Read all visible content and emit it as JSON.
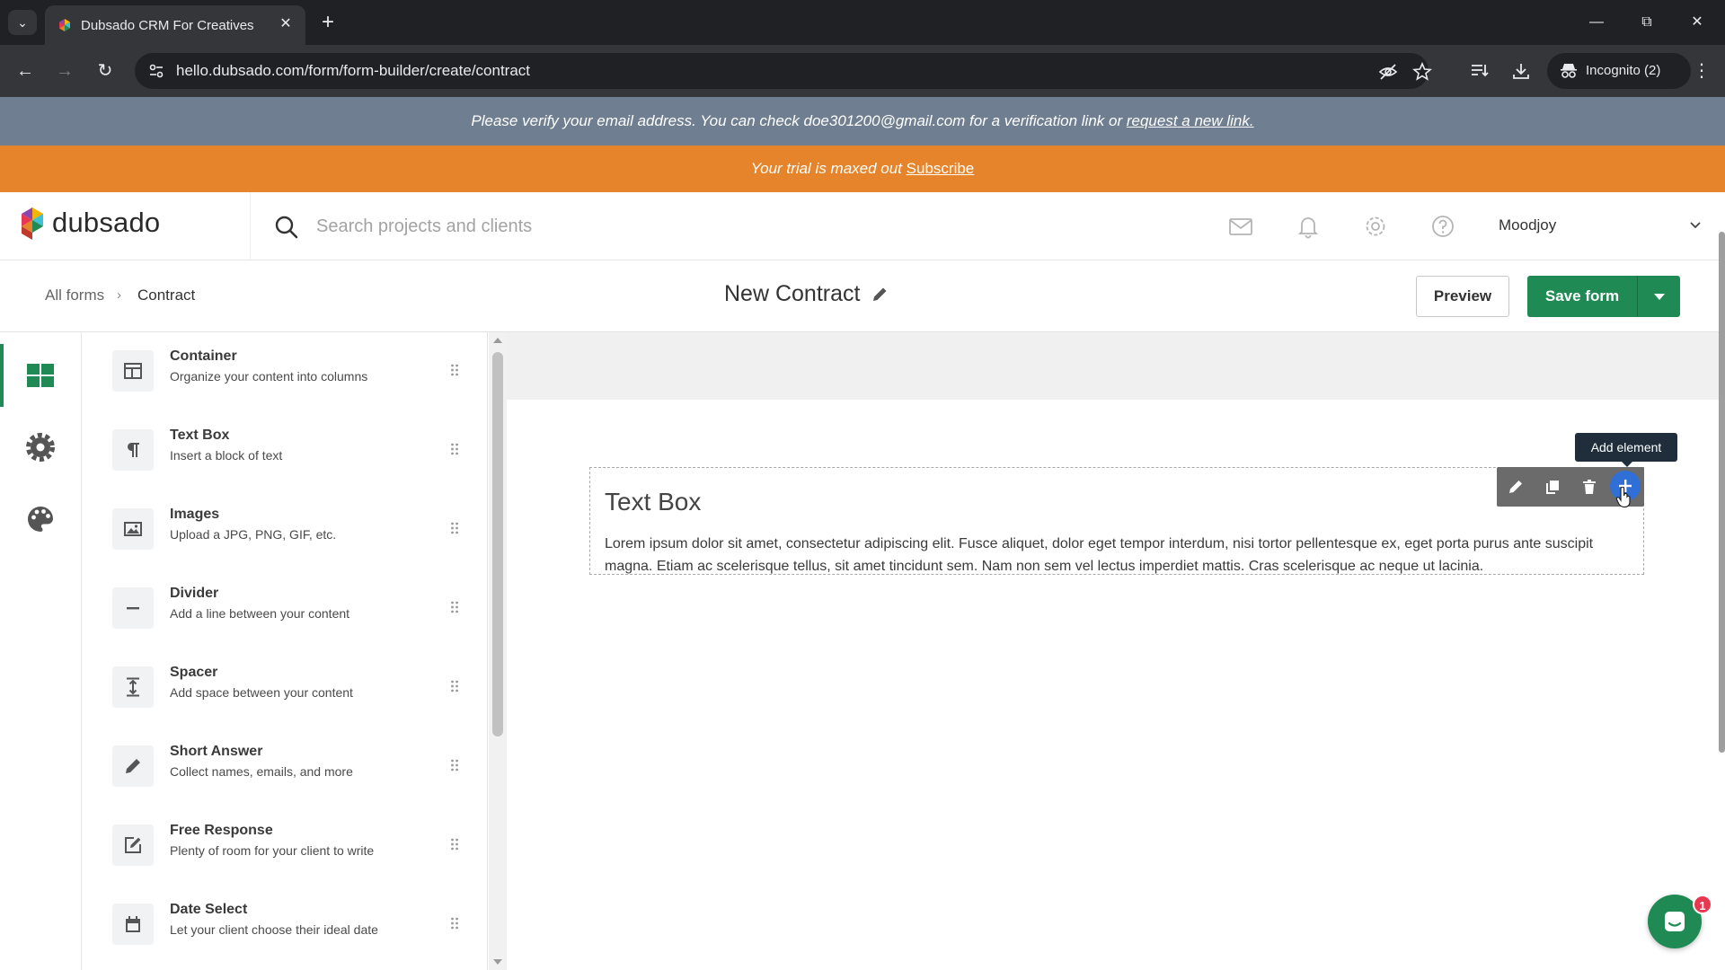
{
  "browser": {
    "tab_title": "Dubsado CRM For Creatives",
    "url": "hello.dubsado.com/form/form-builder/create/contract",
    "incognito_label": "Incognito (2)"
  },
  "banners": {
    "verify_text": "Please verify your email address. You can check doe301200@gmail.com for a verification link or ",
    "verify_link": "request a new link.",
    "trial_text": "Your trial is maxed out ",
    "trial_link": "Subscribe"
  },
  "header": {
    "logo_text": "dubsado",
    "search_placeholder": "Search projects and clients",
    "user_name": "Moodjoy"
  },
  "subheader": {
    "breadcrumb_all": "All forms",
    "breadcrumb_current": "Contract",
    "form_title": "New Contract",
    "preview_label": "Preview",
    "save_label": "Save form"
  },
  "elements": [
    {
      "name": "Container",
      "desc": "Organize your content into columns",
      "icon": "container-icon"
    },
    {
      "name": "Text Box",
      "desc": "Insert a block of text",
      "icon": "paragraph-icon"
    },
    {
      "name": "Images",
      "desc": "Upload a JPG, PNG, GIF, etc.",
      "icon": "image-icon"
    },
    {
      "name": "Divider",
      "desc": "Add a line between your content",
      "icon": "divider-icon"
    },
    {
      "name": "Spacer",
      "desc": "Add space between your content",
      "icon": "spacer-icon"
    },
    {
      "name": "Short Answer",
      "desc": "Collect names, emails, and more",
      "icon": "pencil-icon"
    },
    {
      "name": "Free Response",
      "desc": "Plenty of room for your client to write",
      "icon": "edit-box-icon"
    },
    {
      "name": "Date Select",
      "desc": "Let your client choose their ideal date",
      "icon": "calendar-icon"
    }
  ],
  "canvas": {
    "textbox_title": "Text Box",
    "textbox_body": "Lorem ipsum dolor sit amet, consectetur adipiscing elit. Fusce aliquet, dolor eget tempor interdum, nisi tortor pellentesque ex, eget porta purus ante suscipit magna. Etiam ac scelerisque tellus, sit amet tincidunt sem. Nam non sem vel lectus imperdiet mattis. Cras scelerisque ac neque ut lacinia.",
    "tooltip": "Add element"
  },
  "chat": {
    "badge_count": "1"
  },
  "colors": {
    "brand_green": "#1f8a53",
    "trial_orange": "#e5842a",
    "verify_gray": "#6f7e90",
    "add_blue": "#2f6fd6"
  }
}
